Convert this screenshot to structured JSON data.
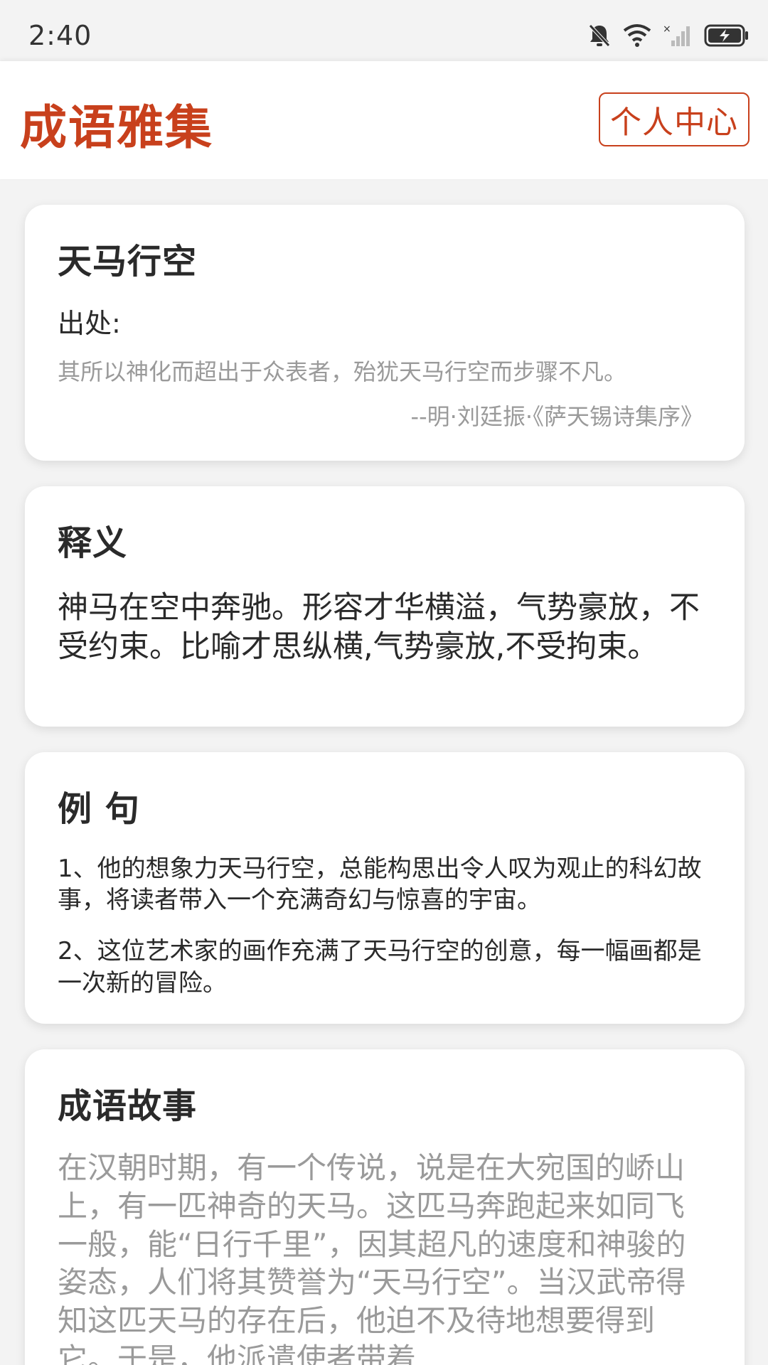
{
  "status_bar": {
    "time": "2:40",
    "icons": [
      "bell-muted-icon",
      "wifi-icon",
      "cell-signal-icon",
      "battery-charging-icon"
    ]
  },
  "header": {
    "title": "成语雅集",
    "profile_button": "个人中心",
    "accent_color": "#c8401c"
  },
  "idiom": {
    "name": "天马行空",
    "origin_label": "出处:",
    "origin_quote": "其所以神化而超出于众表者，殆犹天马行空而步骤不凡。",
    "origin_source": "--明·刘廷振·《萨天锡诗集序》"
  },
  "meaning": {
    "heading": "释义",
    "text": "神马在空中奔驰。形容才华横溢，气势豪放，不受约束。比喻才思纵横,气势豪放,不受拘束。"
  },
  "examples": {
    "heading": "例 句",
    "items": [
      "1、他的想象力天马行空，总能构思出令人叹为观止的科幻故事，将读者带入一个充满奇幻与惊喜的宇宙。",
      "2、这位艺术家的画作充满了天马行空的创意，每一幅画都是一次新的冒险。"
    ]
  },
  "story": {
    "heading": "成语故事",
    "text": "在汉朝时期，有一个传说，说是在大宛国的峤山上，有一匹神奇的天马。这匹马奔跑起来如同飞一般，能“日行千里”，因其超凡的速度和神骏的姿态，人们将其赞誉为“天马行空”。当汉武帝得知这匹天马的存在后，他迫不及待地想要得到它。于是，他派遣使者带着"
  }
}
